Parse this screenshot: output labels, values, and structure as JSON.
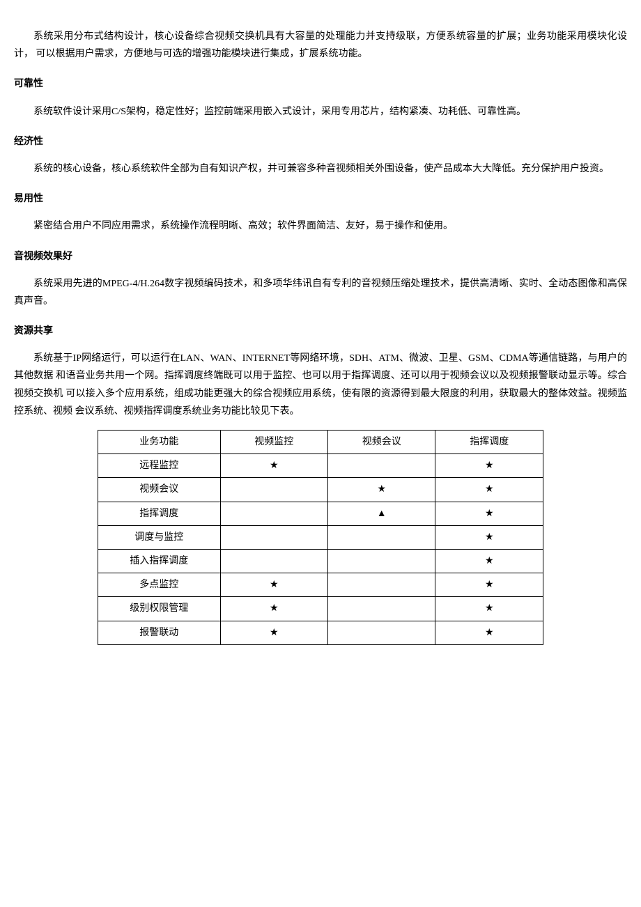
{
  "paragraphs": {
    "p1": "系统采用分布式结构设计，核心设备综合视频交换机具有大容量的处理能力并支持级联，方便系统容量的扩展；业务功能采用模块化设计，  可以根据用户需求，方便地与可选的增强功能模块进行集成，扩展系统功能。",
    "h2": "可靠性",
    "p2": "系统软件设计采用C/S架构，稳定性好；监控前端采用嵌入式设计，采用专用芯片，结构紧凑、功耗低、可靠性高。",
    "h3": "经济性",
    "p3": "系统的核心设备，核心系统软件全部为自有知识产权，并可兼容多种音视频相关外围设备，使产品成本大大降低。充分保护用户投资。",
    "h4": "易用性",
    "p4": "紧密结合用户不同应用需求，系统操作流程明晰、高效；软件界面简洁、友好，易于操作和使用。",
    "h5": "音视频效果好",
    "p5": "系统采用先进的MPEG-4/H.264数字视频编码技术，和多项华纬讯自有专利的音视频压缩处理技术，提供高清晰、实时、全动态图像和高保 真声音。",
    "h6": "资源共享",
    "p6": "系统基于IP网络运行，可以运行在LAN、WAN、INTERNET等网络环境，SDH、ATM、微波、卫星、GSM、CDMA等通信链路，与用户的其他数据 和语音业务共用一个网。指挥调度终端既可以用于监控、也可以用于指挥调度、还可以用于视频会议以及视频报警联动显示等。综合视频交换机 可以接入多个应用系统，组成功能更强大的综合视频应用系统，使有限的资源得到最大限度的利用，获取最大的整体效益。视频监控系统、视频 会议系统、视频指挥调度系统业务功能比较见下表。"
  },
  "table": {
    "headers": [
      "业务功能",
      "视频监控",
      "视频会议",
      "指挥调度"
    ],
    "rows": [
      {
        "label": "远程监控",
        "c1": "★",
        "c2": "",
        "c3": "★"
      },
      {
        "label": "视频会议",
        "c1": "",
        "c2": "★",
        "c3": "★"
      },
      {
        "label": "指挥调度",
        "c1": "",
        "c2": "▲",
        "c3": "★"
      },
      {
        "label": "调度与监控",
        "c1": "",
        "c2": "",
        "c3": "★"
      },
      {
        "label": "插入指挥调度",
        "c1": "",
        "c2": "",
        "c3": "★"
      },
      {
        "label": "多点监控",
        "c1": "★",
        "c2": "",
        "c3": "★"
      },
      {
        "label": "级别权限管理",
        "c1": "★",
        "c2": "",
        "c3": "★"
      },
      {
        "label": "报警联动",
        "c1": "★",
        "c2": "",
        "c3": "★"
      }
    ]
  }
}
